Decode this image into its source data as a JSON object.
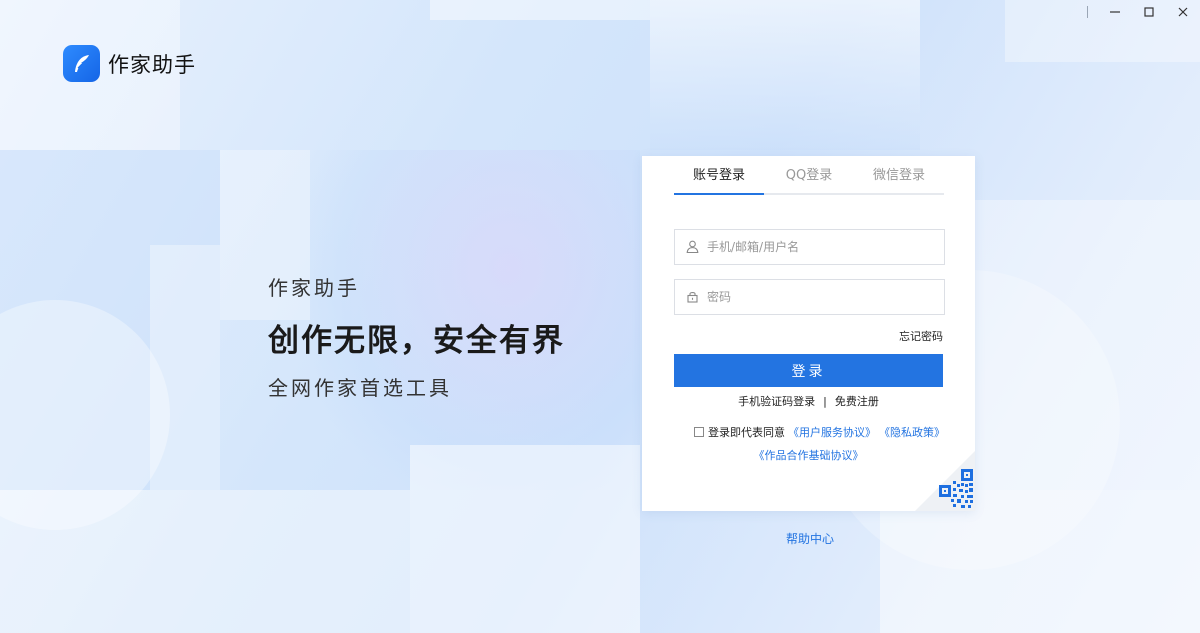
{
  "window": {
    "minimize_icon": "minimize-icon",
    "maximize_icon": "maximize-icon",
    "close_icon": "close-icon"
  },
  "logo": {
    "icon": "feather-pen-icon",
    "text": "作家助手"
  },
  "slogan": {
    "line1": "作家助手",
    "line2": "创作无限，安全有界",
    "line3": "全网作家首选工具"
  },
  "login": {
    "tabs": [
      {
        "label": "账号登录",
        "active": true
      },
      {
        "label": "QQ登录",
        "active": false
      },
      {
        "label": "微信登录",
        "active": false
      }
    ],
    "username_placeholder": "手机/邮箱/用户名",
    "password_placeholder": "密码",
    "forgot_label": "忘记密码",
    "submit_label": "登录",
    "sms_login_label": "手机验证码登录",
    "separator": "|",
    "register_label": "免费注册",
    "agreement_prefix": "登录即代表同意",
    "agreement_user": "《用户服务协议》",
    "agreement_privacy": "《隐私政策》",
    "agreement_cooperation": "《作品合作基础协议》",
    "qr_icon": "qr-code-icon"
  },
  "footer": {
    "help_label": "帮助中心"
  },
  "colors": {
    "accent": "#2374e1",
    "logo_blue": "#1e76f0"
  }
}
